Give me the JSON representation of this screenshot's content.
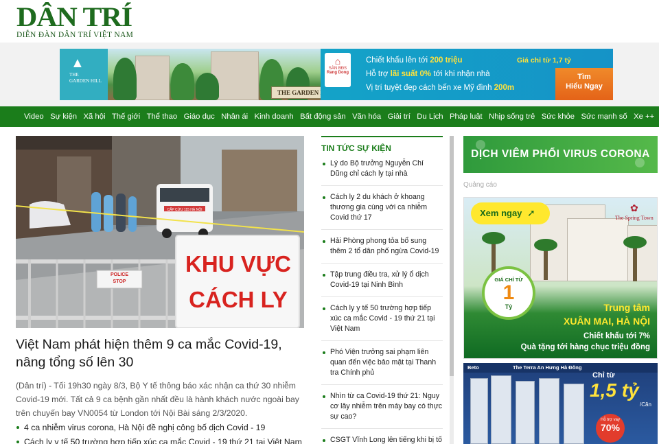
{
  "site": {
    "logo": "DÂN TRÍ",
    "tagline": "DIỄN ĐÀN DÂN TRÍ VIỆT NAM"
  },
  "top_ad": {
    "project": "THE GARDEN HILL",
    "project_small": "THE\nGARDEN HILL",
    "agency_small": "SÀN BĐS",
    "agency_name": "Rang Dong",
    "line1_a": "Chiết khấu lên tới ",
    "line1_b": "200 triệu",
    "line2_a": "Hỗ trợ ",
    "line2_b": "lãi suất 0%",
    "line2_c": " tới khi nhận nhà",
    "line3_a": "Vị trí tuyệt đẹp cách bến xe Mỹ đình ",
    "line3_b": "200m",
    "price_badge": "Giá chỉ từ 1,7 tỷ",
    "cta": "Tìm\nHiểu Ngay"
  },
  "nav": {
    "items": [
      "Video",
      "Sự kiện",
      "Xã hội",
      "Thế giới",
      "Thể thao",
      "Giáo dục",
      "Nhân ái",
      "Kinh doanh",
      "Bất động sản",
      "Văn hóa",
      "Giải trí",
      "Du Lịch",
      "Pháp luật",
      "Nhịp sống trẻ",
      "Sức khỏe",
      "Sức mạnh số",
      "Xe ++"
    ]
  },
  "main_story": {
    "photo_sign_line1": "KHU VỰC",
    "photo_sign_line2": "CÁCH LY",
    "photo_small_sign": "POLICE\nSTOP",
    "photo_ambulance": "CẤP CỨU 115 HÀ NỘI",
    "headline": "Việt Nam phát hiện thêm 9 ca mắc Covid-19, nâng tổng số lên 30",
    "lead": "(Dân trí) - Tối 19h30 ngày 8/3, Bộ Y tế thông báo xác nhận ca thứ 30 nhiễm Covid-19 mới. Tất cả 9 ca bệnh gần nhất đều là hành khách nước ngoài bay trên chuyến bay VN0054 từ London tới Nội Bài sáng 2/3/2020.",
    "related": [
      "4 ca nhiễm virus corona, Hà Nội đề nghị công bố dịch Covid - 19",
      "Cách ly y tế 50 trường hợp tiếp xúc ca mắc Covid - 19 thứ 21 tại Việt Nam"
    ]
  },
  "news_list": {
    "title": "TIN TỨC SỰ KIỆN",
    "items": [
      "Lý do Bộ trưởng Nguyễn Chí Dũng chỉ cách ly tại nhà",
      "Cách ly 2 du khách ở khoang thương gia cùng với ca nhiễm Covid thứ 17",
      "Hải Phòng phong tỏa bổ sung thêm 2 tổ dân phố ngừa Covid-19",
      "Tập trung điều tra, xử lý ổ dịch Covid-19 tại Ninh Bình",
      "Cách ly y tế 50 trường hợp tiếp xúc ca mắc Covid - 19 thứ 21 tại Việt Nam",
      "Phó Viện trưởng sai phạm liên quan đến việc bảo mật tại Thanh tra Chính phủ",
      "Nhìn từ ca Covid-19 thứ 21: Nguy cơ lây nhiễm trên máy bay có thực sự cao?",
      "CSGT Vĩnh Long lên tiếng khi bị tố"
    ]
  },
  "sidebar": {
    "corona_banner": "DỊCH VIÊM PHỔI VIRUS CORONA",
    "ad_label": "Quảng cáo",
    "ad1": {
      "cta": "Xem ngay",
      "brand": "The Spring Town",
      "price_top": "GIÁ CHỈ TỪ",
      "price_value": "1",
      "price_unit": "Tỷ",
      "line1": "Trung tâm",
      "line2": "XUÂN MAI, HÀ NỘI",
      "line3": "Chiết khấu tới 7%",
      "line4": "Quà tặng tới hàng chục triệu đồng"
    },
    "ad2": {
      "brand": "Beto",
      "project": "The Terra An Hưng Hà Đông",
      "price_top": "Chỉ từ",
      "price_value": "1,5 tỷ",
      "price_unit": "/Căn",
      "loan_text": "Hỗ trợ vay",
      "loan_value": "70%"
    }
  },
  "colors": {
    "brand_green": "#1b7d1b",
    "logo_green": "#1e6b1e",
    "ad_blue": "#1593c7",
    "ad_orange": "#e46318",
    "highlight_yellow": "#ffe82e"
  }
}
